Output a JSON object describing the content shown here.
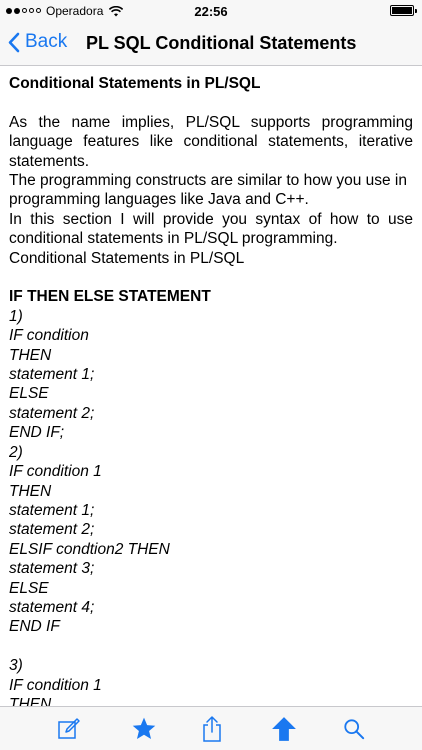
{
  "status_bar": {
    "carrier": "Operadora",
    "time": "22:56",
    "battery_percent": 100
  },
  "nav": {
    "back_label": "Back",
    "title": "PL SQL Conditional Statements"
  },
  "content": {
    "heading": "Conditional Statements in PL/SQL",
    "intro": [
      "As the name implies, PL/SQL supports programming language features like conditional statements, iterative statements.",
      "The programming constructs are similar to how you use in programming languages like Java and C++.",
      "In this section I will provide you syntax of how to use conditional statements in PL/SQL programming.",
      "Conditional Statements in PL/SQL"
    ],
    "section_title": "IF THEN ELSE STATEMENT",
    "code_block_1": [
      "1)",
      "IF condition",
      "THEN",
      "statement 1;",
      "ELSE",
      "statement 2;",
      "END IF;",
      "2)",
      "IF condition 1",
      "THEN",
      "statement 1;",
      "statement 2;",
      "ELSIF condtion2 THEN",
      "statement 3;",
      "ELSE",
      "statement 4;",
      "END IF"
    ],
    "code_block_2": [
      "3)",
      "IF condition 1",
      "THEN"
    ]
  },
  "toolbar": {
    "icons": [
      "edit-icon",
      "star-icon",
      "share-icon",
      "up-arrow-icon",
      "search-icon"
    ],
    "accent_color": "#1a78f0"
  }
}
